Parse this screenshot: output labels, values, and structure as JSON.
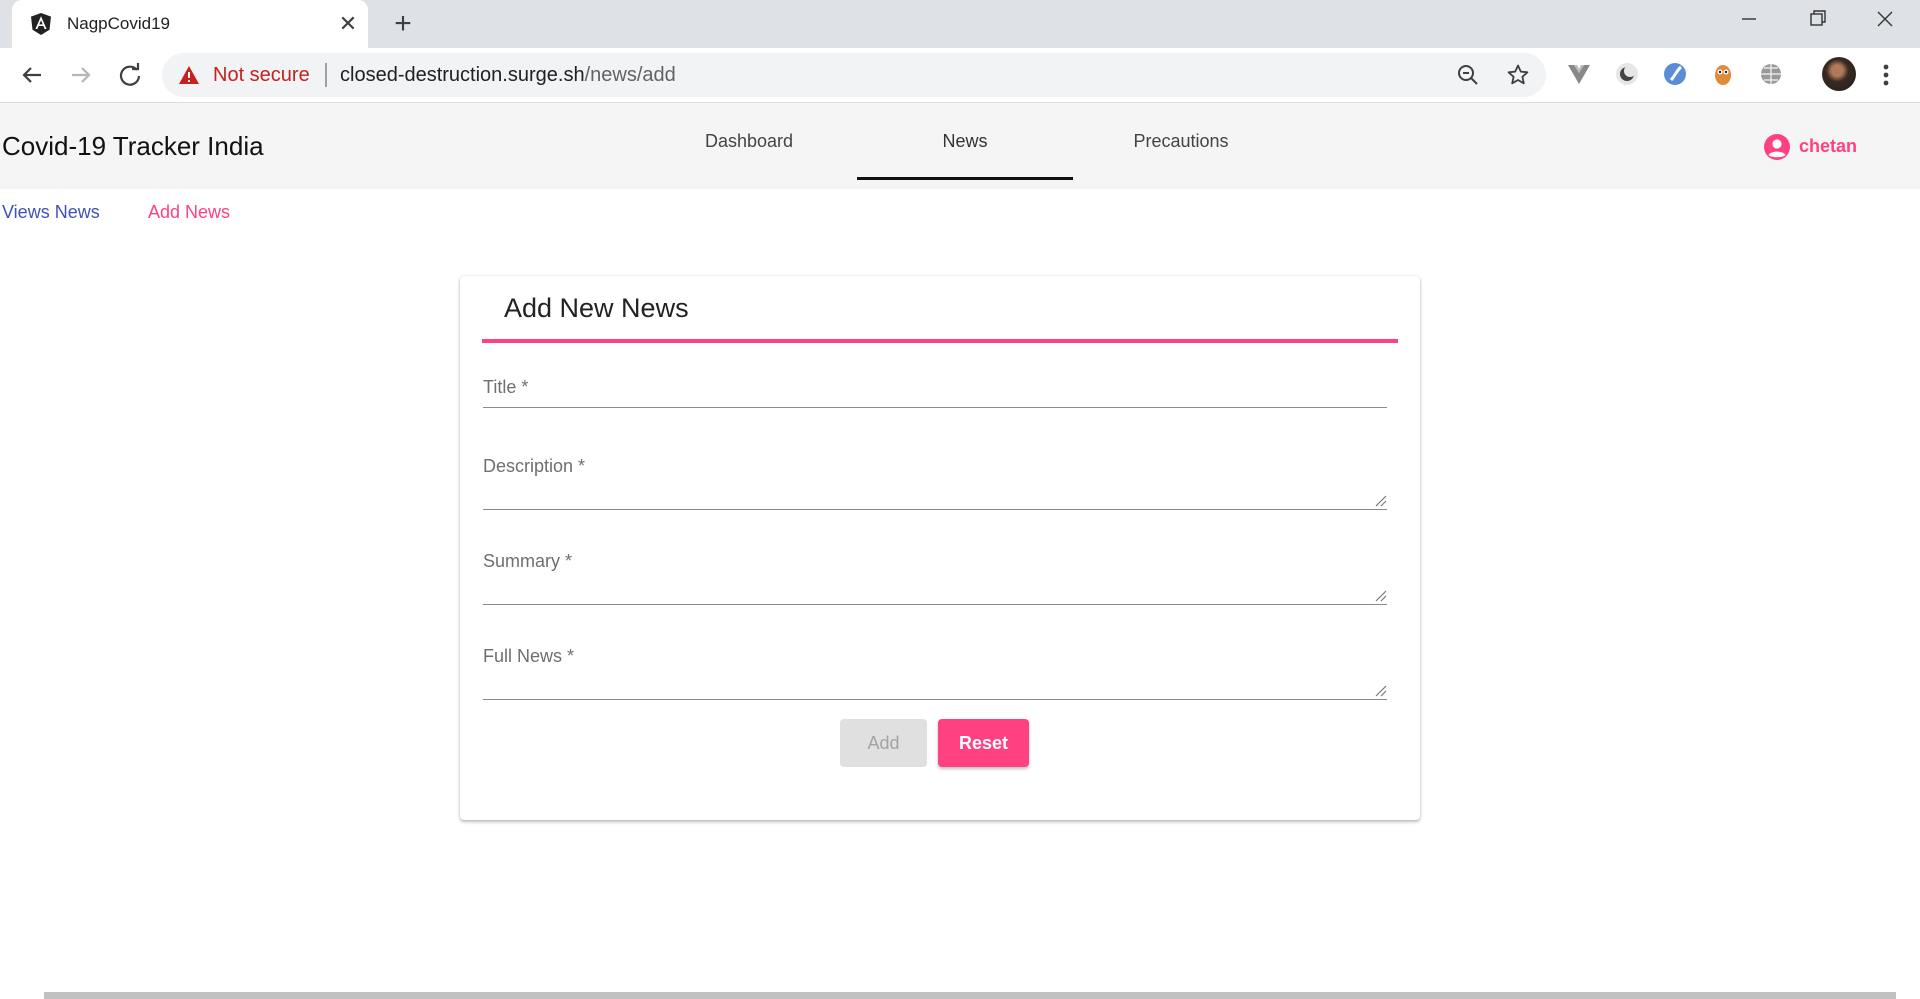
{
  "browser": {
    "tab_title": "NagpCovid19",
    "tab_close": "✕",
    "new_tab": "+",
    "security_label": "Not secure",
    "url_host": "closed-destruction.surge.sh",
    "url_path": "/news/add"
  },
  "header": {
    "app_title": "Covid-19 Tracker India",
    "nav": [
      {
        "label": "Dashboard"
      },
      {
        "label": "News"
      },
      {
        "label": "Precautions"
      }
    ],
    "active_nav": "News",
    "user_name": "chetan"
  },
  "subnav": {
    "views_news": "Views News",
    "add_news": "Add News"
  },
  "form": {
    "title": "Add New News",
    "fields": {
      "title": "Title *",
      "description": "Description *",
      "summary": "Summary *",
      "full_news": "Full News *"
    },
    "add_label": "Add",
    "reset_label": "Reset"
  },
  "colors": {
    "accent": "#ff4081",
    "primary": "#3f51b5",
    "warning": "#c5221f"
  }
}
